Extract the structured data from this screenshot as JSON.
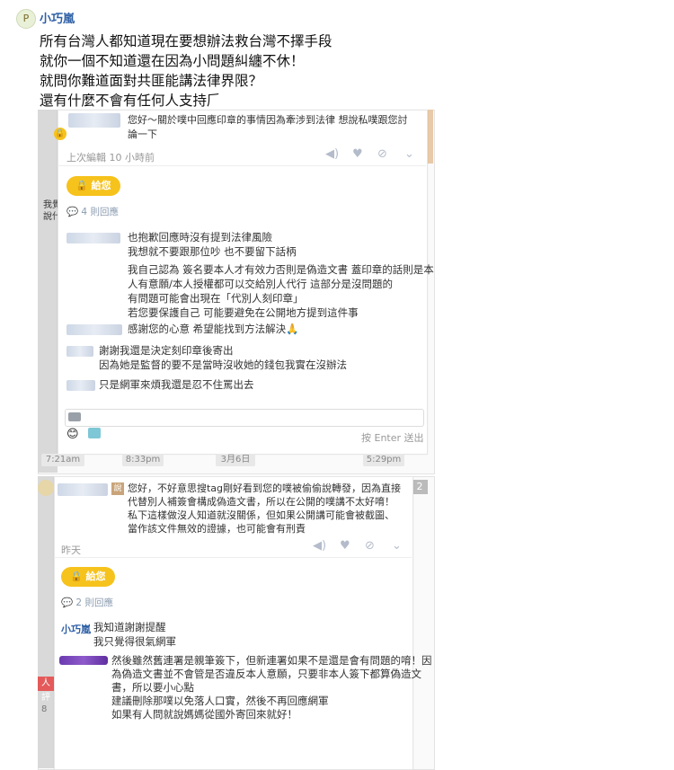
{
  "post": {
    "author": "小巧嵐",
    "avatar_glyph": "P",
    "lines": [
      "所有台灣人都知道現在要想辦法救台灣不擇手段",
      "就你一個不知道還在因為小問題糾纏不休！",
      "就問你難道面對共匪能講法律界限？",
      "還有什麼不會有任何人支持𠂆"
    ]
  },
  "screenshot1": {
    "comment_line1": "您好～關於噗中回應印章的事情因為牽涉到法律 想說私噗跟您討",
    "comment_line2": "論一下",
    "edited": "上次編輯 10 小時前",
    "private_btn": "🔒 給您",
    "replies_count": "4 則回應",
    "side_text_1": "我覺",
    "side_text_2": "說什",
    "msgs": [
      "也抱歉回應時沒有提到法律風險",
      "我想就不要跟那位吵 也不要留下話柄",
      "我自己認為 簽名要本人才有效力否則是偽造文書 蓋印章的話則是本",
      "人有意願/本人授權都可以交給別人代行 這部分是沒問題的",
      "有問題可能會出現在「代別人刻印章」",
      "若您要保護自己 可能要避免在公開地方提到這件事",
      "感謝您的心意 希望能找到方法解決🙏",
      "謝謝我還是決定刻印章後寄出",
      "因為她是監督的要不是當時沒收她的錢包我實在沒辦法",
      "只是網軍來煩我還是忍不住罵出去"
    ],
    "send_hint": "按 Enter 送出",
    "timestamps": [
      "7:21am",
      "8:33pm",
      "3月6日",
      "5:29pm"
    ]
  },
  "screenshot2": {
    "say_badge": "說",
    "comment_lines": [
      "您好，不好意思搜tag剛好看到您的噗被偷偷說轉發，因為直接",
      "代替別人補簽會構成偽造文書，所以在公開的噗講不太好唷！",
      "私下這樣做沒人知道就沒關係，但如果公開講可能會被截圖、",
      "當作該文件無效的證據，也可能會有刑責"
    ],
    "date": "昨天",
    "private_btn": "🔒 給您",
    "replies_count": "2 則回應",
    "reply_author": "小巧嵐",
    "reply_lines": [
      "我知道謝謝提醒",
      "我只覺得很氣網軍"
    ],
    "long_reply": [
      "然後雖然舊連署是親筆簽下，但新連署如果不是還是會有問題的唷！因",
      "為偽造文書並不會管是否違反本人意願，只要非本人簽下都算偽造文",
      "書，所以要小心點",
      "建議刪除那噗以免落人口實，然後不再回應網軍",
      "如果有人問就說媽媽從國外寄回來就好！"
    ],
    "side_number": "2",
    "side_left_text": "人評",
    "side_left_num": "8"
  },
  "colors": {
    "accent_blue": "#2d5fa6",
    "yellow_button": "#f6c21c",
    "blur_purple": "#7a46be"
  }
}
